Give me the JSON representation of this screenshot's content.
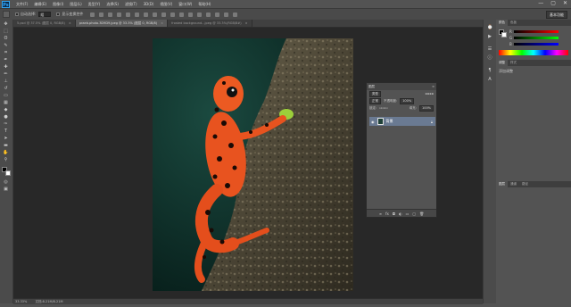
{
  "app": {
    "logo": "Ps"
  },
  "menubar": {
    "items": [
      "文件(F)",
      "编辑(E)",
      "图像(I)",
      "图层(L)",
      "类型(Y)",
      "选择(S)",
      "滤镜(T)",
      "3D(D)",
      "视图(V)",
      "窗口(W)",
      "帮助(H)"
    ],
    "window_buttons": [
      "—",
      "▢",
      "✕"
    ]
  },
  "optionsbar": {
    "auto_select_label": "自动选择:",
    "auto_select_value": "组",
    "show_transform_label": "显示变换控件",
    "workspace": "基本功能"
  },
  "document_tabs": [
    {
      "label": "5.psd @ 37.5% (图层 0, RGB/8)",
      "active": false
    },
    {
      "label": "praeb.photo.3D9D9.jpeg @ 33.3% (图层 0, RGB/8)",
      "active": true
    },
    {
      "label": "frosted background...jpeg @ 33.3%(RGB/8#)",
      "active": false
    }
  ],
  "statusbar": {
    "zoom": "33.33%",
    "doc_info": "文档:8.21M/8.21M"
  },
  "layers_panel": {
    "title": "图层",
    "kind_label": "类型",
    "blend_mode": "正常",
    "opacity_label": "不透明度:",
    "opacity_value": "100%",
    "lock_label": "锁定:",
    "fill_label": "填充:",
    "fill_value": "100%",
    "layer_name": "背景"
  },
  "color_panel": {
    "tabs": [
      "颜色",
      "色板"
    ],
    "channels": [
      "R",
      "G",
      "B"
    ]
  },
  "adjust_panel": {
    "tabs": [
      "调整",
      "样式"
    ],
    "subtitle": "添加调整"
  },
  "bottom_panel": {
    "tabs": [
      "图层",
      "通道",
      "路径"
    ]
  },
  "colors": {
    "accent_blue": "#31a8ff",
    "frog_orange": "#e8531f",
    "layer_selected": "#6a7a92"
  }
}
